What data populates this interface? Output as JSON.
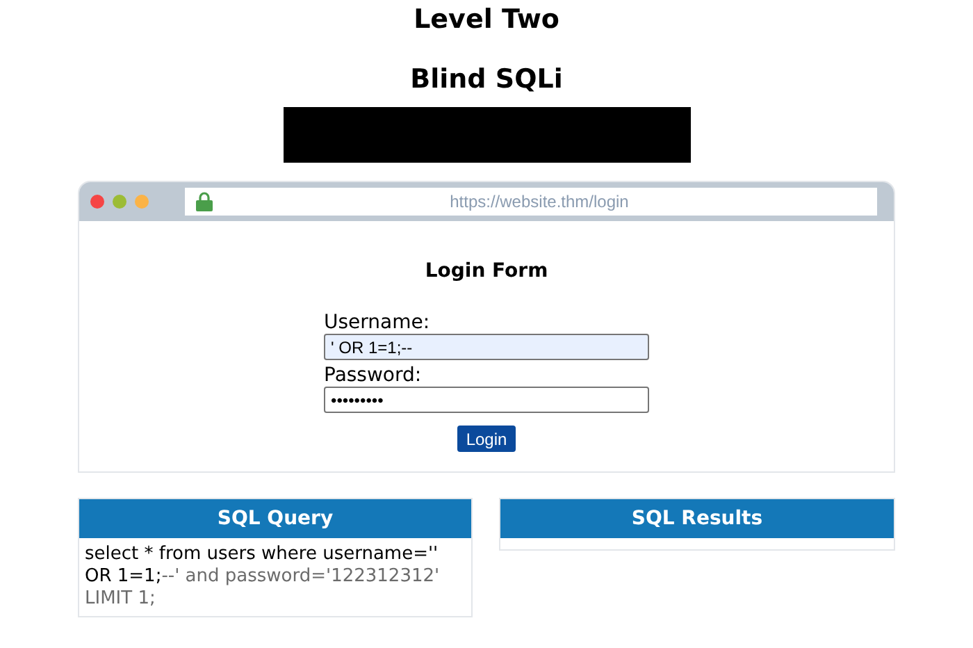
{
  "page": {
    "title": "Level Two",
    "subtitle": "Blind SQLi"
  },
  "browser": {
    "url": "https://website.thm/login"
  },
  "form": {
    "title": "Login Form",
    "fields": [
      {
        "label": "Username:",
        "value": "' OR 1=1;--",
        "autofilled": true
      },
      {
        "label": "Password:",
        "value": "•••••••••",
        "autofilled": false
      }
    ],
    "button": "Login"
  },
  "query_panel": {
    "title": "SQL Query",
    "query": {
      "active": "select * from users where username='' OR 1=1;",
      "commented": "--' and password='122312312' LIMIT 1;"
    }
  },
  "results_panel": {
    "title": "SQL Results"
  }
}
